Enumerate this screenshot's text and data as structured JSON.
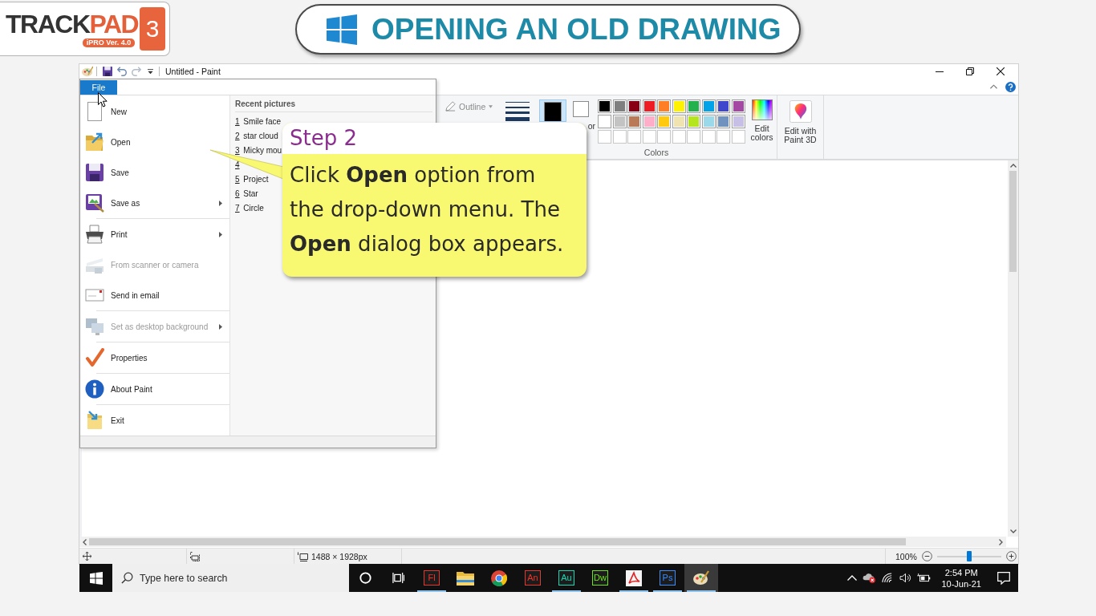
{
  "logo": {
    "brand": "TRACK",
    "brand_accent": "PAD",
    "edition": "iPRO Ver. 4.0",
    "volume": "3"
  },
  "banner": {
    "title": "OPENING AN OLD DRAWING"
  },
  "window": {
    "title": "Untitled - Paint"
  },
  "ribbon": {
    "outline": "Outline",
    "active_colors": [
      {
        "color": "#000000",
        "selected": true
      },
      {
        "color": "#ffffff",
        "selected": false,
        "label": "or"
      }
    ],
    "palette": [
      {
        "kind": "swatch",
        "color": "#000000"
      },
      {
        "kind": "swatch",
        "color": "#7f7f7f"
      },
      {
        "kind": "swatch",
        "color": "#880015"
      },
      {
        "kind": "swatch",
        "color": "#ed1c24"
      },
      {
        "kind": "swatch",
        "color": "#ff7f27"
      },
      {
        "kind": "swatch",
        "color": "#fff200"
      },
      {
        "kind": "swatch",
        "color": "#22b14c"
      },
      {
        "kind": "swatch",
        "color": "#00a2e8"
      },
      {
        "kind": "swatch",
        "color": "#3f48cc"
      },
      {
        "kind": "swatch",
        "color": "#a349a4"
      },
      {
        "kind": "swatch",
        "color": "#ffffff"
      },
      {
        "kind": "swatch",
        "color": "#c3c3c3"
      },
      {
        "kind": "swatch",
        "color": "#b97a57"
      },
      {
        "kind": "swatch",
        "color": "#ffaec9"
      },
      {
        "kind": "swatch",
        "color": "#ffc90e"
      },
      {
        "kind": "swatch",
        "color": "#efe4b0"
      },
      {
        "kind": "swatch",
        "color": "#b5e61d"
      },
      {
        "kind": "swatch",
        "color": "#99d9ea"
      },
      {
        "kind": "swatch",
        "color": "#7092be"
      },
      {
        "kind": "swatch",
        "color": "#c8bfe7"
      },
      {
        "kind": "empty"
      },
      {
        "kind": "empty"
      },
      {
        "kind": "empty"
      },
      {
        "kind": "empty"
      },
      {
        "kind": "empty"
      },
      {
        "kind": "empty"
      },
      {
        "kind": "empty"
      },
      {
        "kind": "empty"
      },
      {
        "kind": "empty"
      },
      {
        "kind": "empty"
      }
    ],
    "edit_colors": "Edit colors",
    "paint_3d": "Edit with Paint 3D",
    "group_label": "Colors"
  },
  "file_menu": {
    "tab": {
      "label": "File",
      "selected": true
    },
    "groups": [
      [
        {
          "label": "New",
          "disabled": false,
          "submenu": false
        },
        {
          "label": "Open",
          "disabled": false,
          "submenu": false
        },
        {
          "label": "Save",
          "disabled": false,
          "submenu": false
        },
        {
          "label": "Save as",
          "disabled": false,
          "submenu": true
        }
      ],
      [
        {
          "label": "Print",
          "disabled": false,
          "submenu": true
        },
        {
          "label": "From scanner or camera",
          "disabled": true,
          "submenu": false
        },
        {
          "label": "Send in email",
          "disabled": false,
          "submenu": false
        }
      ],
      [
        {
          "label": "Set as desktop background",
          "disabled": true,
          "submenu": true
        }
      ],
      [
        {
          "label": "Properties",
          "disabled": false,
          "submenu": false
        }
      ],
      [
        {
          "label": "About Paint",
          "disabled": false,
          "submenu": false
        }
      ],
      [
        {
          "label": "Exit",
          "disabled": false,
          "submenu": false
        }
      ]
    ],
    "recent": {
      "title": "Recent pictures",
      "items": [
        {
          "number": "1",
          "name": "Smile face"
        },
        {
          "number": "2",
          "name": "star cloud"
        },
        {
          "number": "3",
          "name": "Micky mou"
        },
        {
          "number": "4"
        },
        {
          "number": "5",
          "name": "Project"
        },
        {
          "number": "6",
          "name": "Star"
        },
        {
          "number": "7",
          "name": "Circle"
        }
      ]
    }
  },
  "callout": {
    "title": "Step 2",
    "text": "Click **Open** option from the drop-down menu. The **Open** dialog box appears."
  },
  "status_bar": {
    "dimensions": "1488 × 1928px",
    "zoom": "100%",
    "zoom_slider": {
      "level": 0.5
    }
  },
  "taskbar": {
    "search": {
      "placeholder": "Type here to search"
    },
    "apps": [
      {
        "kind": "tile",
        "label": "Fl",
        "color": "#e8362c",
        "running": true,
        "active": false
      },
      {
        "kind": "icon",
        "running": false,
        "active": false
      },
      {
        "kind": "icon",
        "running": false,
        "active": false
      },
      {
        "kind": "tile",
        "label": "An",
        "color": "#e8362c",
        "running": false,
        "active": false
      },
      {
        "kind": "tile",
        "label": "Au",
        "color": "#19d6b0",
        "running": true,
        "active": false
      },
      {
        "kind": "tile",
        "label": "Dw",
        "color": "#6fe21a",
        "running": false,
        "active": false
      },
      {
        "kind": "icon",
        "running": true,
        "active": false
      },
      {
        "kind": "tile",
        "label": "Ps",
        "color": "#3a8cff",
        "running": true,
        "active": false
      },
      {
        "kind": "icon",
        "running": true,
        "active": true
      }
    ],
    "time": "2:54 PM",
    "date": "10-Jun-21"
  }
}
